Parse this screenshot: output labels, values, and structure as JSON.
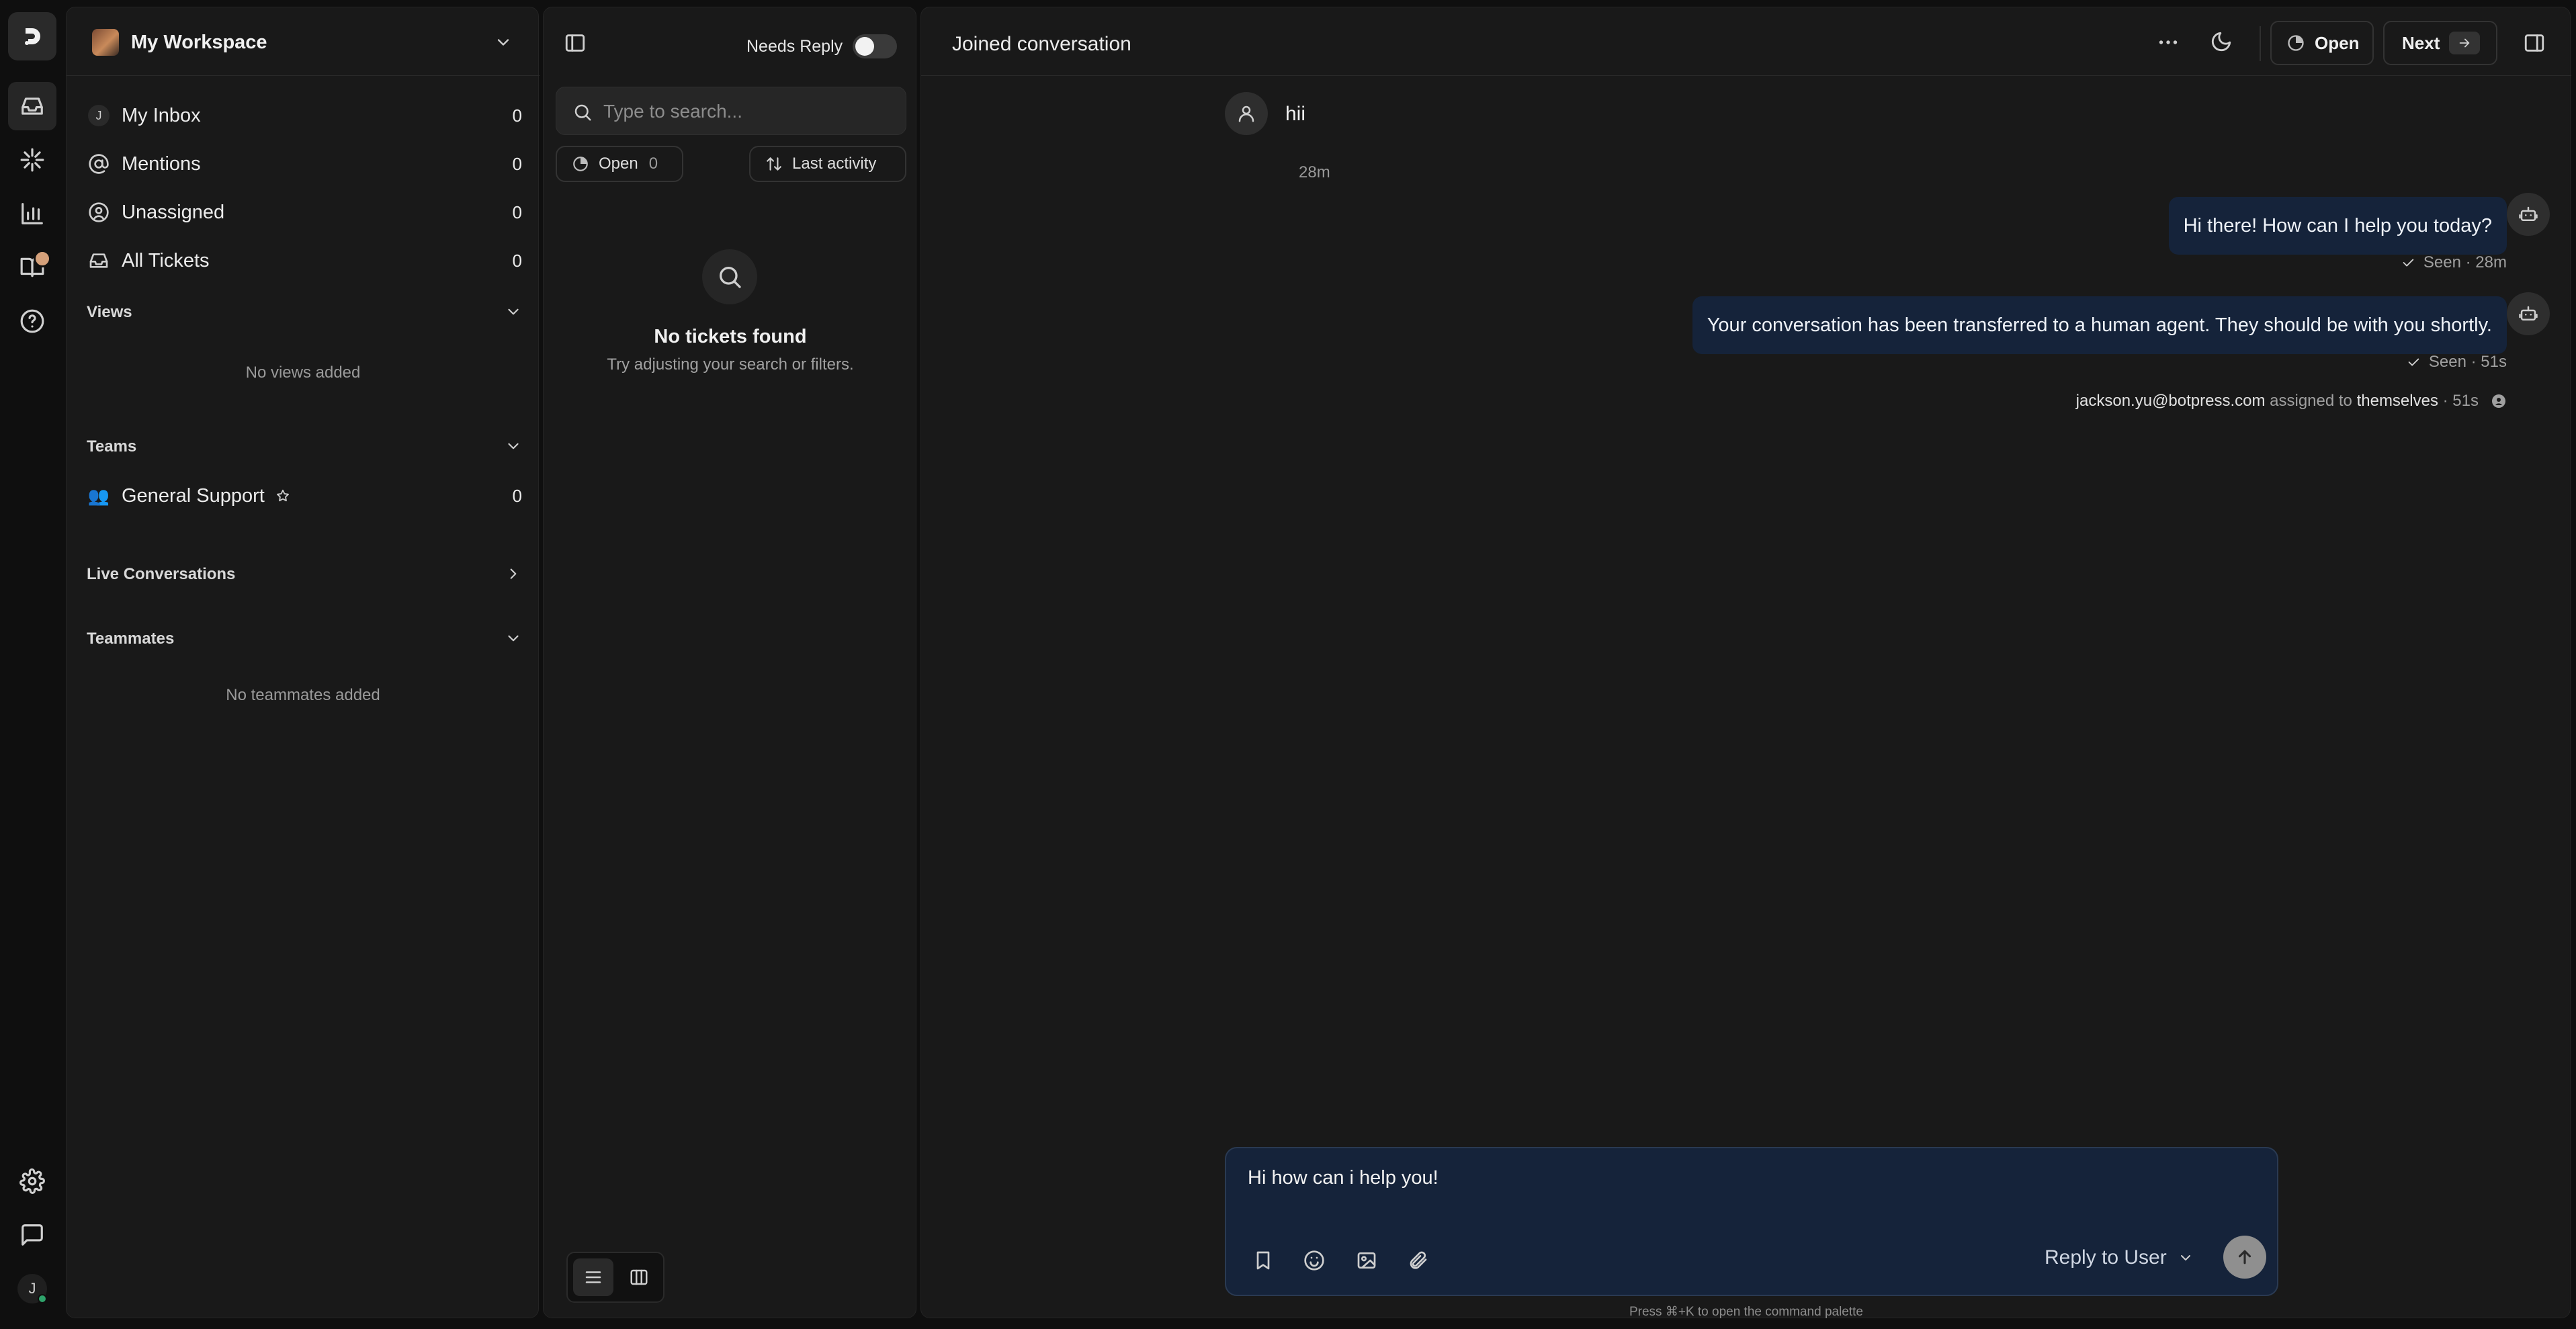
{
  "workspace": {
    "name": "My Workspace"
  },
  "nav": {
    "items": [
      {
        "label": "My Inbox",
        "count": "0",
        "chip": "J"
      },
      {
        "label": "Mentions",
        "count": "0"
      },
      {
        "label": "Unassigned",
        "count": "0"
      },
      {
        "label": "All Tickets",
        "count": "0"
      }
    ]
  },
  "views": {
    "title": "Views",
    "empty": "No views added"
  },
  "teams": {
    "title": "Teams",
    "items": [
      {
        "label": "General Support",
        "count": "0",
        "emoji": "👥"
      }
    ]
  },
  "live": {
    "title": "Live Conversations"
  },
  "teammates": {
    "title": "Teammates",
    "empty": "No teammates added"
  },
  "rail": {
    "avatar_initial": "J",
    "icons": [
      "logo-icon",
      "inbox-icon",
      "sparkle-icon",
      "analytics-icon",
      "book-icon",
      "help-icon",
      "settings-icon",
      "chat-icon"
    ]
  },
  "tickets": {
    "needs_reply_label": "Needs Reply",
    "needs_reply_on": false,
    "search_placeholder": "Type to search...",
    "status_filter": {
      "label": "Open",
      "count": "0"
    },
    "sort_label": "Last activity",
    "empty_title": "No tickets found",
    "empty_sub": "Try adjusting your search or filters."
  },
  "conversation": {
    "title": "Joined conversation",
    "status_button": "Open",
    "next_button": "Next",
    "messages": [
      {
        "from": "user",
        "text": "hii",
        "time": "28m"
      },
      {
        "from": "bot",
        "text": "Hi there! How can I help you today?",
        "status": "Seen · 28m"
      },
      {
        "from": "bot",
        "text": "Your conversation has been transferred to a human agent. They should be with you shortly.",
        "status": "Seen · 51s"
      }
    ],
    "system_event": {
      "actor": "jackson.yu@botpress.com",
      "verb": " assigned to ",
      "target": "themselves",
      "time": " · 51s"
    },
    "composer": {
      "text": "Hi how can i help you!",
      "reply_mode": "Reply to User"
    },
    "command_hint": "Press ⌘+K to open the command palette"
  },
  "colors": {
    "background": "#0f0f0f",
    "panel": "#191919",
    "bot_bubble": "#15233a",
    "online": "#2fa36b",
    "notification": "#d4a07a"
  }
}
